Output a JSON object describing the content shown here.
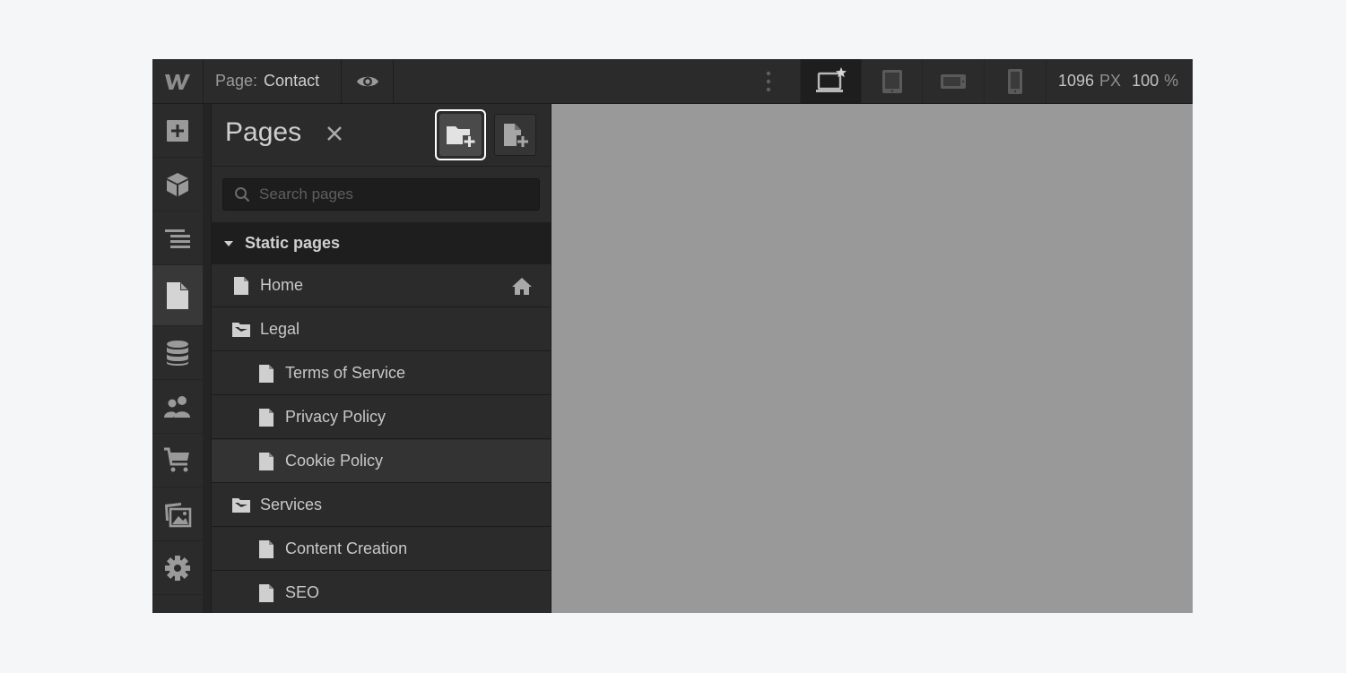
{
  "topbar": {
    "logo": "W",
    "page_prefix": "Page:",
    "page_name": "Contact",
    "width_value": "1096",
    "width_unit": "PX",
    "zoom_value": "100",
    "zoom_unit": "%",
    "breakpoints": [
      {
        "icon": "desktop-star-icon",
        "active": true
      },
      {
        "icon": "tablet-icon",
        "active": false
      },
      {
        "icon": "mobile-landscape-icon",
        "active": false
      },
      {
        "icon": "mobile-portrait-icon",
        "active": false
      }
    ]
  },
  "rail": {
    "items": [
      {
        "icon": "add-icon",
        "active": false
      },
      {
        "icon": "cube-icon",
        "active": false
      },
      {
        "icon": "navigator-icon",
        "active": false
      },
      {
        "icon": "page-icon",
        "active": true
      },
      {
        "icon": "database-icon",
        "active": false
      },
      {
        "icon": "users-icon",
        "active": false
      },
      {
        "icon": "cart-icon",
        "active": false
      },
      {
        "icon": "assets-icon",
        "active": false
      },
      {
        "icon": "gear-icon",
        "active": false
      }
    ]
  },
  "panel": {
    "title": "Pages",
    "search_placeholder": "Search pages",
    "section_label": "Static pages",
    "rows": [
      {
        "label": "Home",
        "type": "page",
        "indent": 0,
        "home": true
      },
      {
        "label": "Legal",
        "type": "folder",
        "indent": 0
      },
      {
        "label": "Terms of Service",
        "type": "page",
        "indent": 1
      },
      {
        "label": "Privacy Policy",
        "type": "page",
        "indent": 1
      },
      {
        "label": "Cookie Policy",
        "type": "page",
        "indent": 1,
        "highlighted": true
      },
      {
        "label": "Services",
        "type": "folder",
        "indent": 0
      },
      {
        "label": "Content Creation",
        "type": "page",
        "indent": 1
      },
      {
        "label": "SEO",
        "type": "page",
        "indent": 1
      }
    ]
  },
  "colors": {
    "app_bg": "#2b2b2b",
    "canvas_bg": "#999999",
    "page_bg": "#f5f6f8",
    "highlight_outline": "#ffffff"
  }
}
